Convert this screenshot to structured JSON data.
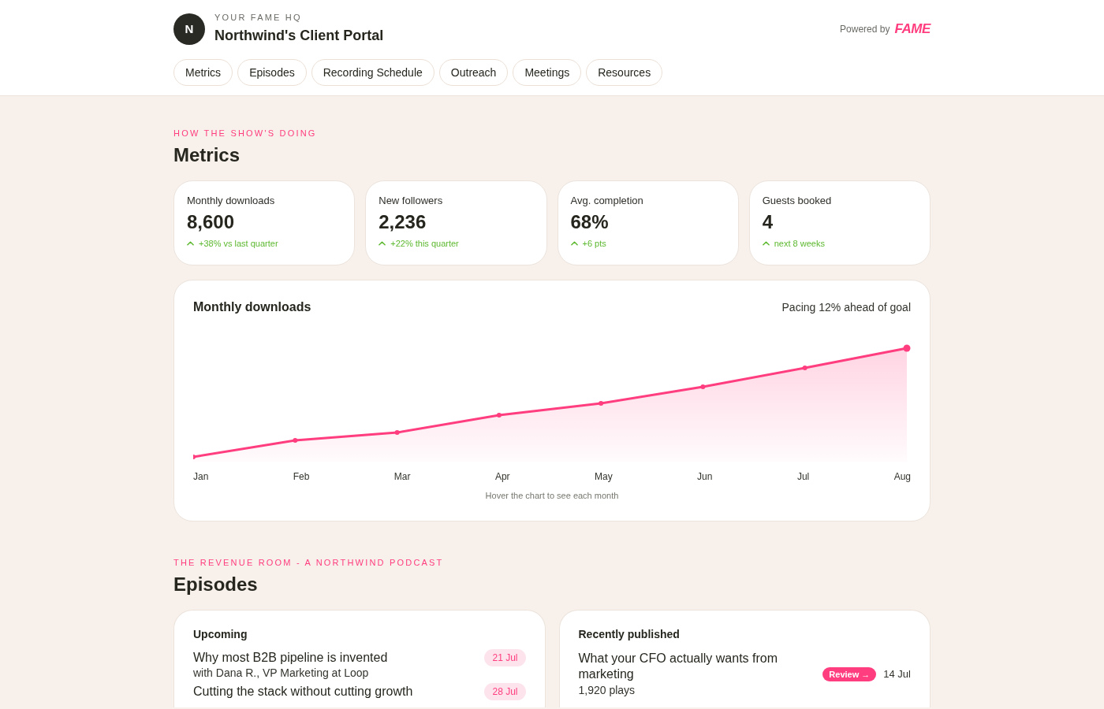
{
  "header": {
    "avatar_initial": "N",
    "eyebrow": "YOUR FAME HQ",
    "title": "Northwind's Client Portal",
    "powered_by": "Powered by",
    "logo_text": "FAME"
  },
  "tabs": [
    {
      "label": "Metrics",
      "selected": false
    },
    {
      "label": "Episodes",
      "selected": false
    },
    {
      "label": "Recording Schedule",
      "selected": false
    },
    {
      "label": "Outreach",
      "selected": false
    },
    {
      "label": "Meetings",
      "selected": false
    },
    {
      "label": "Resources",
      "selected": false
    }
  ],
  "metrics_section": {
    "eyebrow": "HOW THE SHOW'S DOING",
    "heading": "Metrics",
    "cards": [
      {
        "label": "Monthly downloads",
        "value": "8,600",
        "delta": "+38% vs last quarter"
      },
      {
        "label": "New followers",
        "value": "2,236",
        "delta": "+22% this quarter"
      },
      {
        "label": "Avg. completion",
        "value": "68%",
        "delta": "+6 pts"
      },
      {
        "label": "Guests booked",
        "value": "4",
        "delta": "next 8 weeks"
      }
    ]
  },
  "chart": {
    "title": "Monthly downloads",
    "note": "Pacing 12% ahead of goal",
    "months": [
      "Jan",
      "Feb",
      "Mar",
      "Apr",
      "May",
      "Jun",
      "Jul",
      "Aug"
    ],
    "hint": "Hover the chart to see each month"
  },
  "episodes_section": {
    "eyebrow": "THE REVENUE ROOM - A NORTHWIND PODCAST",
    "heading": "Episodes",
    "upcoming": {
      "title": "Upcoming",
      "items": [
        {
          "title": "Why most B2B pipeline is invented",
          "subtitle": "with Dana R., VP Marketing at Loop",
          "date": "21 Jul"
        },
        {
          "title": "Cutting the stack without cutting growth",
          "date": "28 Jul"
        }
      ]
    },
    "published": {
      "title": "Recently published",
      "items": [
        {
          "title": "What your CFO actually wants from marketing",
          "plays": "1,920 plays",
          "action": "Review →",
          "date": "14 Jul"
        }
      ]
    }
  }
}
